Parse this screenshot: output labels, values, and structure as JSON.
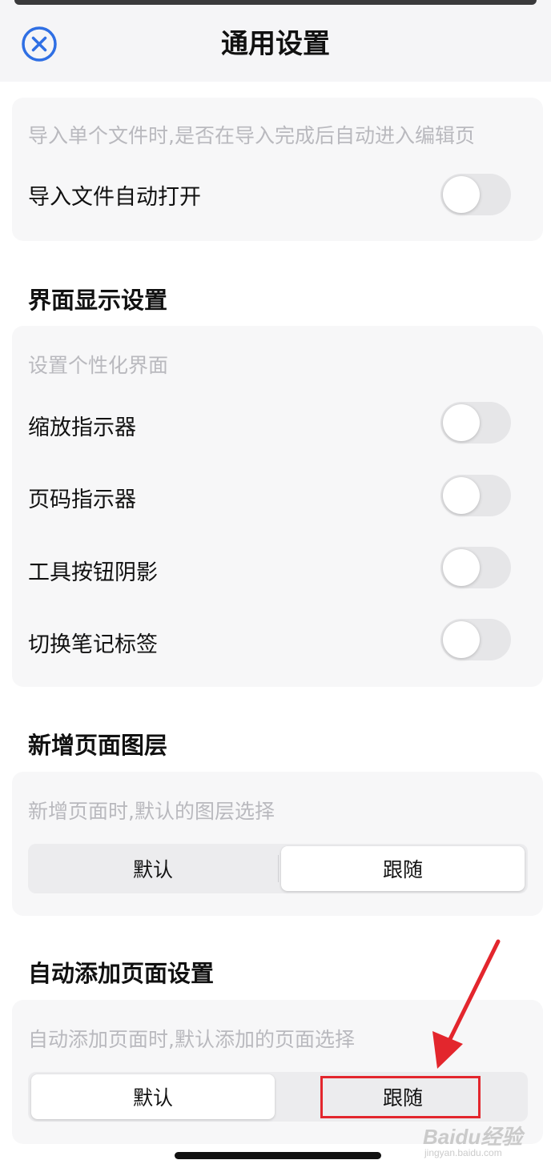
{
  "header": {
    "title": "通用设置",
    "close_icon": "close-circle-icon",
    "accent_color": "#2f6fe4"
  },
  "import_card": {
    "description": "导入单个文件时,是否在导入完成后自动进入编辑页",
    "rows": [
      {
        "label": "导入文件自动打开",
        "enabled": false
      }
    ]
  },
  "display_section": {
    "title": "界面显示设置",
    "description": "设置个性化界面",
    "rows": [
      {
        "label": "缩放指示器",
        "enabled": false
      },
      {
        "label": "页码指示器",
        "enabled": false
      },
      {
        "label": "工具按钮阴影",
        "enabled": false
      },
      {
        "label": "切换笔记标签",
        "enabled": false
      }
    ]
  },
  "new_page_layer_section": {
    "title": "新增页面图层",
    "description": "新增页面时,默认的图层选择",
    "options": [
      "默认",
      "跟随"
    ],
    "selected": "跟随"
  },
  "auto_add_section": {
    "title": "自动添加页面设置",
    "description": "自动添加页面时,默认添加的页面选择",
    "options": [
      "默认",
      "跟随"
    ],
    "selected": "默认"
  },
  "annotation": {
    "highlight_color": "#e3262d",
    "target": "跟随"
  },
  "watermark": {
    "logo": "Baidu经验",
    "url": "jingyan.baidu.com"
  }
}
